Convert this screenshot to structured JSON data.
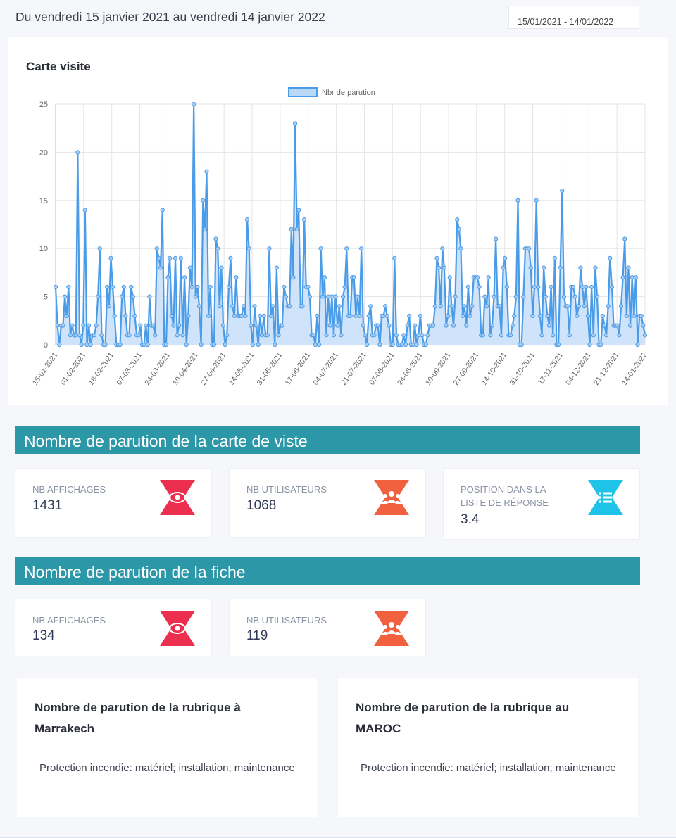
{
  "header": {
    "date_range_text": "Du vendredi 15 janvier 2021 au vendredi 14 janvier 2022",
    "date_picker_value": "15/01/2021 - 14/01/2022"
  },
  "chart_card": {
    "title": "Carte visite"
  },
  "chart_data": {
    "type": "area",
    "title": "Carte visite",
    "legend": "Nbr de parution",
    "legend_position": "top",
    "ylim": [
      0,
      25
    ],
    "y_ticks": [
      0,
      5,
      10,
      15,
      20,
      25
    ],
    "grid": true,
    "line_color": "#4a9be8",
    "fill_color": "#cfe3fa",
    "x_tick_labels": [
      "15-01-2021",
      "01-02-2021",
      "18-02-2021",
      "07-03-2021",
      "24-03-2021",
      "10-04-2021",
      "27-04-2021",
      "14-05-2021",
      "31-05-2021",
      "17-06-2021",
      "04-07-2021",
      "21-07-2021",
      "07-08-2021",
      "24-08-2021",
      "10-09-2021",
      "27-09-2021",
      "14-10-2021",
      "31-10-2021",
      "17-11-2021",
      "04-12-2021",
      "21-12-2021",
      "14-01-2022"
    ],
    "series": [
      {
        "name": "Nbr de parution",
        "values": [
          6,
          2,
          0,
          2,
          2,
          5,
          3,
          6,
          1,
          2,
          1,
          1,
          20,
          1,
          0,
          2,
          14,
          0,
          2,
          0,
          1,
          1,
          2,
          5,
          10,
          1,
          0,
          0,
          6,
          4,
          9,
          6,
          3,
          0,
          0,
          0,
          5,
          6,
          3,
          1,
          1,
          6,
          5,
          3,
          1,
          1,
          2,
          0,
          0,
          2,
          0,
          5,
          2,
          2,
          1,
          10,
          9,
          8,
          14,
          0,
          0,
          7,
          9,
          3,
          2,
          9,
          1,
          2,
          9,
          1,
          7,
          0,
          3,
          8,
          6,
          25,
          5,
          6,
          4,
          0,
          15,
          12,
          18,
          3,
          6,
          0,
          0,
          11,
          10,
          4,
          8,
          2,
          0,
          1,
          6,
          9,
          4,
          3,
          7,
          3,
          3,
          3,
          4,
          3,
          13,
          10,
          2,
          0,
          4,
          2,
          0,
          3,
          1,
          3,
          1,
          1,
          10,
          3,
          4,
          0,
          8,
          1,
          2,
          2,
          6,
          5,
          4,
          4,
          12,
          7,
          23,
          12,
          14,
          4,
          4,
          13,
          6,
          6,
          5,
          1,
          1,
          0,
          3,
          0,
          10,
          5,
          7,
          1,
          5,
          2,
          5,
          1,
          5,
          2,
          4,
          1,
          5,
          6,
          10,
          3,
          3,
          7,
          7,
          3,
          5,
          3,
          10,
          2,
          1,
          0,
          3,
          4,
          1,
          1,
          2,
          2,
          0,
          3,
          3,
          4,
          3,
          2,
          0,
          0,
          9,
          1,
          0,
          0,
          0,
          1,
          0,
          2,
          3,
          0,
          0,
          2,
          0,
          1,
          3,
          1,
          0,
          0,
          1,
          2,
          2,
          2,
          4,
          9,
          8,
          4,
          10,
          8,
          2,
          3,
          7,
          4,
          2,
          5,
          13,
          12,
          10,
          3,
          4,
          2,
          6,
          3,
          4,
          7,
          7,
          7,
          6,
          1,
          1,
          5,
          4,
          7,
          1,
          2,
          5,
          11,
          4,
          4,
          1,
          8,
          9,
          6,
          1,
          1,
          2,
          3,
          5,
          15,
          0,
          0,
          5,
          10,
          10,
          10,
          8,
          3,
          6,
          15,
          6,
          3,
          1,
          8,
          5,
          3,
          2,
          6,
          1,
          9,
          0,
          0,
          8,
          16,
          5,
          4,
          4,
          1,
          6,
          6,
          5,
          3,
          4,
          8,
          6,
          4,
          6,
          3,
          0,
          6,
          1,
          8,
          5,
          0,
          0,
          3,
          2,
          1,
          4,
          9,
          6,
          2,
          2,
          2,
          1,
          4,
          7,
          11,
          3,
          8,
          2,
          7,
          3,
          7,
          0,
          3,
          3,
          2,
          1
        ]
      }
    ]
  },
  "section_carte": {
    "title": "Nombre de parution de la carte de viste",
    "stats": [
      {
        "label": "NB AFFICHAGES",
        "value": "1431",
        "icon": "eye-icon",
        "color": "#ec2f4f"
      },
      {
        "label": "NB UTILISATEURS",
        "value": "1068",
        "icon": "users-icon",
        "color": "#f2613f"
      },
      {
        "label": "POSITION DANS LA LISTE DE RÉPONSE",
        "value": "3.4",
        "icon": "list-icon",
        "color": "#1fc3e8"
      }
    ]
  },
  "section_fiche": {
    "title": "Nombre de parution de la fiche",
    "stats": [
      {
        "label": "NB AFFICHAGES",
        "value": "134",
        "icon": "eye-icon",
        "color": "#ec2f4f"
      },
      {
        "label": "NB UTILISATEURS",
        "value": "119",
        "icon": "users-icon",
        "color": "#f2613f"
      }
    ]
  },
  "rubriques": [
    {
      "title": "Nombre de parution de la rubrique à Marrakech",
      "item": "Protection incendie: matériel; installation; maintenance"
    },
    {
      "title": "Nombre de parution de la rubrique au MAROC",
      "item": "Protection incendie: matériel; installation; maintenance"
    }
  ]
}
